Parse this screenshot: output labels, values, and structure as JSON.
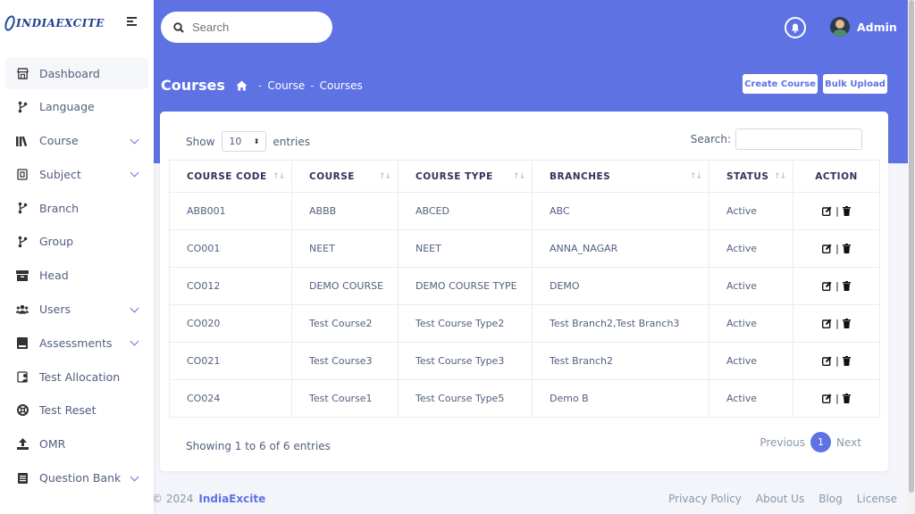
{
  "brand": {
    "name": "INDIAEXCITE"
  },
  "sidebar": {
    "items": [
      {
        "label": "Dashboard",
        "icon": "store-icon",
        "expandable": false,
        "active": true
      },
      {
        "label": "Language",
        "icon": "code-branch-icon",
        "expandable": false
      },
      {
        "label": "Course",
        "icon": "books-icon",
        "expandable": true
      },
      {
        "label": "Subject",
        "icon": "subject-icon",
        "expandable": true
      },
      {
        "label": "Branch",
        "icon": "code-branch-icon",
        "expandable": false
      },
      {
        "label": "Group",
        "icon": "code-branch-icon",
        "expandable": false
      },
      {
        "label": "Head",
        "icon": "archive-icon",
        "expandable": false
      },
      {
        "label": "Users",
        "icon": "users-icon",
        "expandable": true
      },
      {
        "label": "Assessments",
        "icon": "book-icon",
        "expandable": true
      },
      {
        "label": "Test Allocation",
        "icon": "user-tag-icon",
        "expandable": false
      },
      {
        "label": "Test Reset",
        "icon": "life-ring-icon",
        "expandable": false
      },
      {
        "label": "OMR",
        "icon": "upload-icon",
        "expandable": false
      },
      {
        "label": "Question Bank",
        "icon": "clipboard-icon",
        "expandable": true
      }
    ]
  },
  "header": {
    "search_placeholder": "Search",
    "user_name": "Admin",
    "page_title": "Courses",
    "breadcrumb": [
      "Course",
      "Courses"
    ],
    "create_label": "Create Course",
    "bulk_label": "Bulk Upload",
    "accent_color": "#5e72e4"
  },
  "table_controls": {
    "show_label": "Show",
    "page_size": "10",
    "entries_label": "entries",
    "search_label": "Search:"
  },
  "table": {
    "columns": [
      "COURSE CODE",
      "COURSE",
      "COURSE TYPE",
      "BRANCHES",
      "STATUS",
      "ACTION"
    ],
    "rows": [
      {
        "code": "ABB001",
        "course": "ABBB",
        "type": "ABCED",
        "branches": "ABC",
        "status": "Active"
      },
      {
        "code": "CO001",
        "course": "NEET",
        "type": "NEET",
        "branches": "ANNA_NAGAR",
        "status": "Active"
      },
      {
        "code": "CO012",
        "course": "DEMO COURSE",
        "type": "DEMO COURSE TYPE",
        "branches": "DEMO",
        "status": "Active"
      },
      {
        "code": "CO020",
        "course": "Test Course2",
        "type": "Test Course Type2",
        "branches": "Test Branch2,Test Branch3",
        "status": "Active"
      },
      {
        "code": "CO021",
        "course": "Test Course3",
        "type": "Test Course Type3",
        "branches": "Test Branch2",
        "status": "Active"
      },
      {
        "code": "CO024",
        "course": "Test Course1",
        "type": "Test Course Type5",
        "branches": "Demo B",
        "status": "Active"
      }
    ]
  },
  "pagination": {
    "info": "Showing 1 to 6 of 6 entries",
    "previous": "Previous",
    "current": "1",
    "next": "Next"
  },
  "footer": {
    "copyright": "© 2024",
    "brand_link": "IndiaExcite",
    "links": [
      "Privacy Policy",
      "About Us",
      "Blog",
      "License"
    ]
  }
}
